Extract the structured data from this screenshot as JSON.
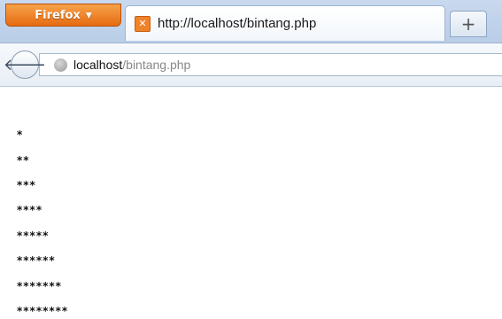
{
  "browser": {
    "menu_button_label": "Firefox",
    "tab": {
      "title": "http://localhost/bintang.php",
      "favicon_icon": "xampp-icon"
    },
    "new_tab_label": "+",
    "nav": {
      "back_icon": "back-arrow-icon",
      "url_host": "localhost",
      "url_path": "/bintang.php"
    }
  },
  "page": {
    "rows": [
      "*",
      "**",
      "***",
      "****",
      "*****",
      "******",
      "*******",
      "********"
    ]
  }
}
